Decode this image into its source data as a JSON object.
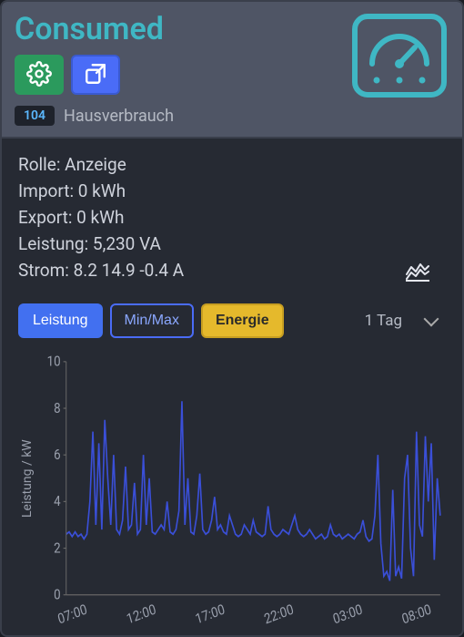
{
  "header": {
    "title": "Consumed",
    "badge_value": "104",
    "badge_label": "Hausverbrauch"
  },
  "info": {
    "rolle": "Rolle: Anzeige",
    "import": "Import: 0 kWh",
    "export": "Export: 0 kWh",
    "leistung": "Leistung: 5,230 VA",
    "strom": "Strom: 8.2 14.9 -0.4 A"
  },
  "controls": {
    "leistung": "Leistung",
    "minmax": "Min/Max",
    "energie": "Energie",
    "range": "1 Tag"
  },
  "chart_data": {
    "type": "line",
    "title": "",
    "xlabel": "",
    "ylabel": "Leistung / kW",
    "ylim": [
      0,
      10
    ],
    "yticks": [
      0,
      2,
      4,
      6,
      8,
      10
    ],
    "x_categories": [
      "07:00",
      "12:00",
      "17:00",
      "22:00",
      "03:00",
      "08:00"
    ],
    "series": [
      {
        "name": "Leistung",
        "color": "#3a4fd8",
        "values": [
          2.6,
          2.7,
          2.5,
          2.7,
          2.5,
          2.6,
          2.4,
          2.6,
          4.0,
          7.0,
          3.0,
          6.5,
          2.8,
          7.5,
          5.0,
          3.0,
          6.0,
          2.8,
          2.6,
          3.2,
          5.5,
          2.8,
          3.0,
          4.8,
          2.6,
          2.8,
          6.0,
          3.0,
          5.0,
          2.7,
          2.6,
          2.8,
          3.0,
          2.8,
          4.0,
          2.7,
          2.6,
          2.8,
          3.6,
          8.3,
          3.0,
          5.0,
          2.7,
          2.6,
          3.4,
          5.2,
          2.8,
          2.6,
          2.7,
          3.2,
          4.2,
          2.8,
          3.0,
          2.7,
          2.6,
          3.4,
          3.0,
          2.6,
          2.5,
          2.6,
          3.0,
          2.8,
          2.6,
          3.2,
          2.7,
          2.6,
          2.5,
          2.6,
          3.8,
          2.8,
          2.6,
          2.5,
          2.6,
          2.8,
          2.7,
          2.6,
          3.0,
          3.4,
          2.8,
          2.6,
          2.5,
          2.6,
          2.8,
          2.6,
          2.4,
          2.5,
          2.6,
          2.4,
          2.5,
          3.0,
          2.6,
          2.5,
          2.6,
          2.4,
          2.5,
          2.6,
          2.5,
          2.4,
          2.6,
          2.7,
          3.2,
          2.5,
          2.3,
          2.4,
          3.4,
          6.0,
          2.2,
          0.8,
          1.0,
          0.6,
          4.5,
          0.8,
          1.2,
          0.7,
          5.0,
          6.0,
          2.0,
          0.8,
          7.0,
          3.0,
          2.5,
          6.8,
          4.0,
          6.5,
          1.5,
          5.0,
          3.4
        ]
      }
    ]
  }
}
